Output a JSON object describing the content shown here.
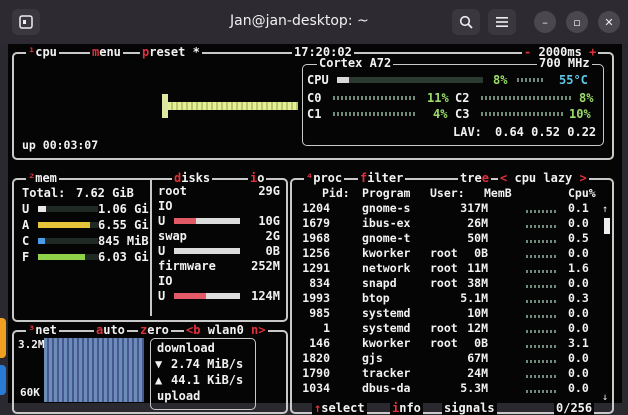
{
  "window": {
    "title": "Jan@jan-desktop: ~"
  },
  "cpu_box": {
    "tabs": [
      "cpu",
      "menu",
      "preset"
    ],
    "clock": "17:20:02",
    "interval": "2000ms",
    "uptime": "up 00:03:07",
    "model": "Cortex A72",
    "freq": "700 MHz",
    "cpu_label": "CPU",
    "cpu_pct": "8%",
    "cpu_temp": "55°C",
    "cores": [
      {
        "name": "C0",
        "pct": "11%"
      },
      {
        "name": "C1",
        "pct": "4%"
      },
      {
        "name": "C2",
        "pct": "8%"
      },
      {
        "name": "C3",
        "pct": "10%"
      }
    ],
    "lav_label": "LAV:",
    "lav": "0.64 0.52 0.22"
  },
  "mem_box": {
    "title": "mem",
    "total_label": "Total:",
    "total": "7.62 GiB",
    "rows": [
      {
        "key": "U",
        "value": "1.06 Gi",
        "color": "#e8e8e8",
        "fill": 0.14
      },
      {
        "key": "A",
        "value": "6.55 Gi",
        "color": "#e6c43a",
        "fill": 0.86
      },
      {
        "key": "C",
        "value": "845 MiB",
        "color": "#4a9be8",
        "fill": 0.11
      },
      {
        "key": "F",
        "value": "6.03 Gi",
        "color": "#8fd24a",
        "fill": 0.79
      }
    ]
  },
  "disks_box": {
    "title": "disks",
    "io_tab": "io",
    "rows": [
      {
        "name": "root",
        "size": "29G"
      },
      {
        "name": "IO",
        "size": ""
      },
      {
        "name": "U",
        "size": "10G",
        "fill": 0.34
      },
      {
        "name": "swap",
        "size": "2G"
      },
      {
        "name": "U",
        "size": "0B",
        "fill": 0.0
      },
      {
        "name": "firmware",
        "size": "252M"
      },
      {
        "name": "IO",
        "size": ""
      },
      {
        "name": "U",
        "size": "124M",
        "fill": 0.49
      }
    ]
  },
  "net_box": {
    "tabs": [
      "net",
      "auto",
      "zero"
    ],
    "iface": "<b wlan0 n>",
    "scale_top": "3.2M",
    "scale_bottom": "60K",
    "download_label": "download",
    "down_rate": "2.74 MiB/s",
    "up_rate": "44.1 KiB/s",
    "upload_label": "upload"
  },
  "proc_box": {
    "tabs": [
      "proc",
      "filter",
      "tree"
    ],
    "sort": "< cpu lazy >",
    "headers": {
      "pid": "Pid:",
      "program": "Program",
      "user": "User:",
      "mem": "MemB",
      "cpu": "Cpu%"
    },
    "rows": [
      {
        "pid": "1204",
        "program": "gnome-s",
        "user": "",
        "mem": "317M",
        "cpu": "0.1"
      },
      {
        "pid": "1679",
        "program": "ibus-ex",
        "user": "",
        "mem": "26M",
        "cpu": "0.0"
      },
      {
        "pid": "1968",
        "program": "gnome-t",
        "user": "",
        "mem": "50M",
        "cpu": "0.5"
      },
      {
        "pid": "1256",
        "program": "kworker",
        "user": "root",
        "mem": "0B",
        "cpu": "0.0"
      },
      {
        "pid": "1291",
        "program": "network",
        "user": "root",
        "mem": "11M",
        "cpu": "1.6"
      },
      {
        "pid": "834",
        "program": "snapd",
        "user": "root",
        "mem": "38M",
        "cpu": "0.0"
      },
      {
        "pid": "1993",
        "program": "btop",
        "user": "",
        "mem": "5.1M",
        "cpu": "0.3"
      },
      {
        "pid": "985",
        "program": "systemd",
        "user": "",
        "mem": "10M",
        "cpu": "0.0"
      },
      {
        "pid": "1",
        "program": "systemd",
        "user": "root",
        "mem": "12M",
        "cpu": "0.0"
      },
      {
        "pid": "146",
        "program": "kworker",
        "user": "root",
        "mem": "0B",
        "cpu": "3.1"
      },
      {
        "pid": "1820",
        "program": "gjs",
        "user": "",
        "mem": "67M",
        "cpu": "0.0"
      },
      {
        "pid": "1790",
        "program": "tracker",
        "user": "",
        "mem": "24M",
        "cpu": "0.0"
      },
      {
        "pid": "1034",
        "program": "dbus-da",
        "user": "",
        "mem": "5.3M",
        "cpu": "0.0"
      }
    ],
    "footer": {
      "select": "select",
      "info": "info",
      "signals": "signals",
      "count": "0/256"
    }
  }
}
